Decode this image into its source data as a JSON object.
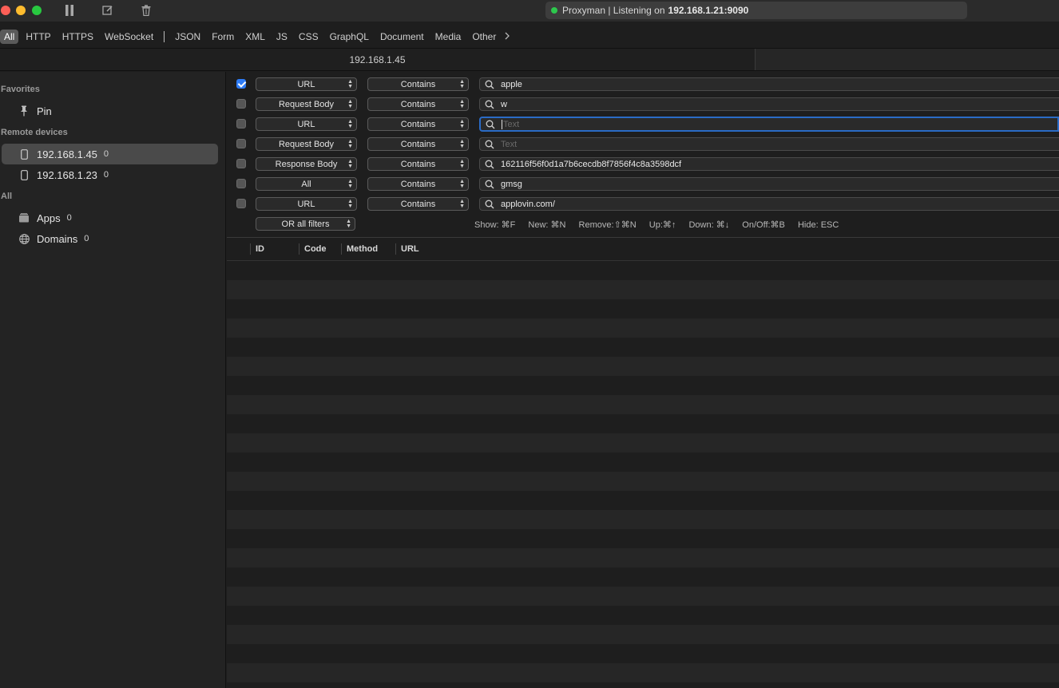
{
  "titlebar": {
    "status_prefix": "Proxyman | Listening on",
    "status_address": "192.168.1.21:9090"
  },
  "type_filters": [
    "All",
    "HTTP",
    "HTTPS",
    "WebSocket",
    "JSON",
    "Form",
    "XML",
    "JS",
    "CSS",
    "GraphQL",
    "Document",
    "Media",
    "Other"
  ],
  "tab": {
    "label": "192.168.1.45"
  },
  "sidebar": {
    "favorites_label": "Favorites",
    "pin_label": "Pin",
    "remote_label": "Remote devices",
    "devices": [
      {
        "name": "192.168.1.45",
        "count": "0"
      },
      {
        "name": "192.168.1.23",
        "count": "0"
      }
    ],
    "all_label": "All",
    "apps": {
      "label": "Apps",
      "count": "0"
    },
    "domains": {
      "label": "Domains",
      "count": "0"
    }
  },
  "filters": [
    {
      "checked": true,
      "field": "URL",
      "operator": "Contains",
      "value": "apple",
      "placeholder": "Text"
    },
    {
      "checked": false,
      "field": "Request Body",
      "operator": "Contains",
      "value": "w",
      "placeholder": "Text"
    },
    {
      "checked": false,
      "field": "URL",
      "operator": "Contains",
      "value": "",
      "placeholder": "Text"
    },
    {
      "checked": false,
      "field": "Request Body",
      "operator": "Contains",
      "value": "",
      "placeholder": "Text"
    },
    {
      "checked": false,
      "field": "Response Body",
      "operator": "Contains",
      "value": "162116f56f0d1a7b6cecdb8f7856f4c8a3598dcf",
      "placeholder": "Text"
    },
    {
      "checked": false,
      "field": "All",
      "operator": "Contains",
      "value": "gmsg",
      "placeholder": "Text"
    },
    {
      "checked": false,
      "field": "URL",
      "operator": "Contains",
      "value": "applovin.com/",
      "placeholder": "Text"
    }
  ],
  "combine": {
    "label": "OR all filters"
  },
  "shortcuts": [
    "Show: ⌘F",
    "New: ⌘N",
    "Remove:⇧⌘N",
    "Up:⌘↑",
    "Down: ⌘↓",
    "On/Off:⌘B",
    "Hide: ESC"
  ],
  "table": {
    "columns": [
      "ID",
      "Code",
      "Method",
      "URL"
    ]
  }
}
